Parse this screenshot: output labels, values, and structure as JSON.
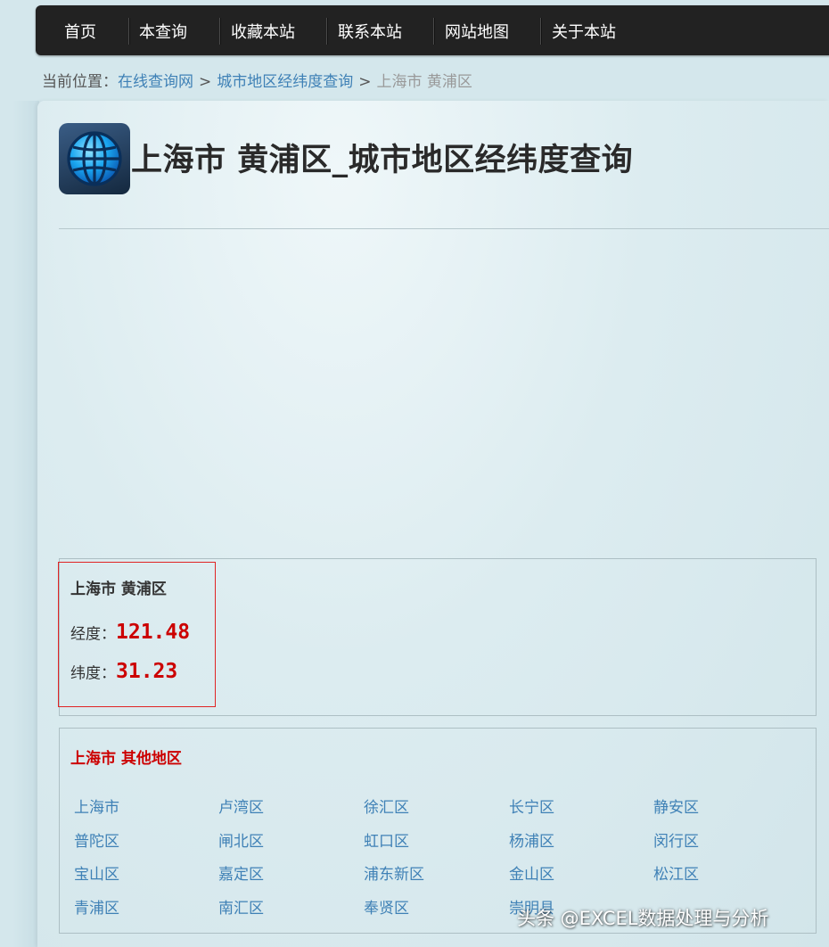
{
  "nav": {
    "items": [
      "首页",
      "本查询",
      "收藏本站",
      "联系本站",
      "网站地图",
      "关于本站"
    ]
  },
  "breadcrumb": {
    "prefix": "当前位置：",
    "links": [
      "在线查询网",
      "城市地区经纬度查询"
    ],
    "separator": ">",
    "current": "上海市 黄浦区"
  },
  "header": {
    "title": "上海市 黄浦区_城市地区经纬度查询",
    "logo_icon": "globe-icon"
  },
  "result": {
    "name": "上海市 黄浦区",
    "longitude_label": "经度：",
    "longitude_value": "121.48",
    "latitude_label": "纬度：",
    "latitude_value": "31.23"
  },
  "others": {
    "title": "上海市 其他地区",
    "districts": [
      "上海市",
      "卢湾区",
      "徐汇区",
      "长宁区",
      "静安区",
      "普陀区",
      "闸北区",
      "虹口区",
      "杨浦区",
      "闵行区",
      "宝山区",
      "嘉定区",
      "浦东新区",
      "金山区",
      "松江区",
      "青浦区",
      "南汇区",
      "奉贤区",
      "崇明县"
    ]
  },
  "watermark": "头条 @EXCEL数据处理与分析",
  "colors": {
    "nav_bg": "#222222",
    "link": "#3f81b6",
    "value_red": "#cc0000",
    "page_bg": "#d4e7ec"
  }
}
